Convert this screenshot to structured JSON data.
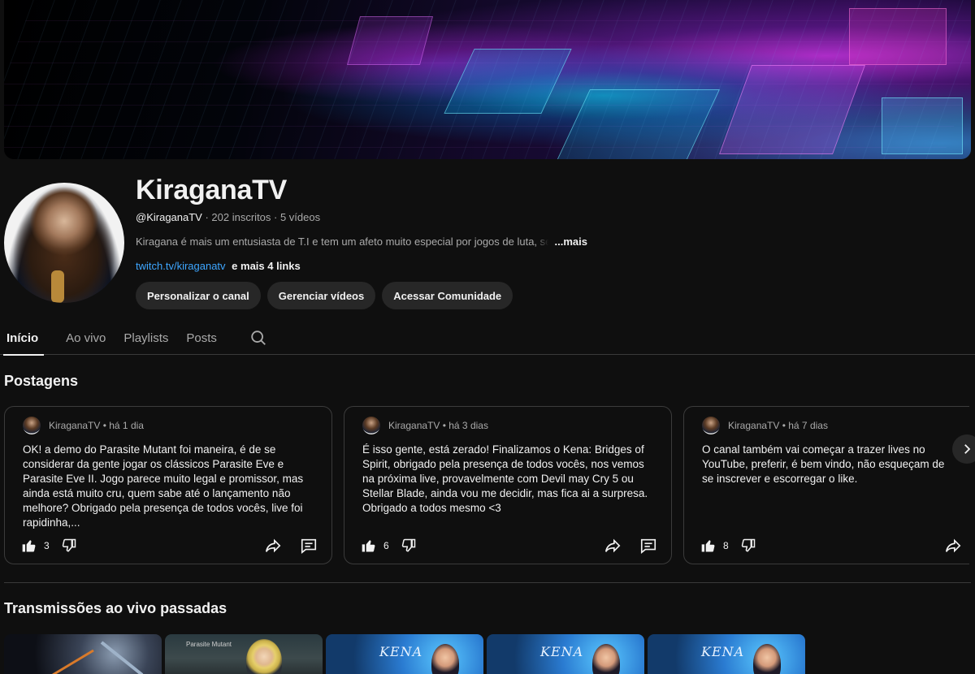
{
  "channel": {
    "name": "KiraganaTV",
    "handle": "@KiraganaTV",
    "stats": "· 202 inscritos · 5 vídeos",
    "description": "Kiragana é mais um entusiasta de T.I e tem um afeto muito especial por jogos de luta, sem",
    "more_label": "...mais",
    "link": "twitch.tv/kiraganatv",
    "more_links": "e mais 4 links",
    "actions": [
      "Personalizar o canal",
      "Gerenciar vídeos",
      "Acessar Comunidade"
    ]
  },
  "tabs": [
    "Início",
    "Ao vivo",
    "Playlists",
    "Posts"
  ],
  "sections": {
    "posts_title": "Postagens",
    "live_title": "Transmissões ao vivo passadas"
  },
  "posts": [
    {
      "author": "KiraganaTV",
      "time": "• há 1 dia",
      "text": "OK! a demo do Parasite Mutant foi maneira, é de se considerar da gente jogar os clássicos Parasite Eve e Parasite Eve II. Jogo parece muito legal e promissor, mas ainda está muito cru, quem sabe até o lançamento não melhore? Obrigado pela presença de todos vocês, live foi rapidinha,...",
      "likes": "3"
    },
    {
      "author": "KiraganaTV",
      "time": "• há 3 dias",
      "text": "É isso gente, está zerado! Finalizamos o Kena: Bridges of Spirit, obrigado pela presença de todos vocês, nos vemos na próxima live, provavelmente com Devil may Cry 5 ou Stellar Blade, ainda vou me decidir, mas fica ai a surpresa. Obrigado a todos mesmo <3",
      "likes": "6"
    },
    {
      "author": "KiraganaTV",
      "time": "• há 7 dias",
      "text": "O canal também vai começar a trazer lives no YouTube, preferir, é bem vindo, não esqueçam de se inscrever e escorregar o like.",
      "likes": "8"
    }
  ],
  "thumbnails": [
    {
      "label": ""
    },
    {
      "label": "Parasite Mutant"
    },
    {
      "label": "KENA"
    },
    {
      "label": "KENA"
    },
    {
      "label": "KENA"
    }
  ],
  "colors": {
    "background": "#0f0f0f",
    "pill": "#272727",
    "link": "#3ea6ff",
    "muted": "#aaaaaa"
  },
  "icons": [
    "search-icon",
    "like-icon",
    "dislike-icon",
    "share-icon",
    "comment-icon",
    "chevron-right-icon"
  ]
}
